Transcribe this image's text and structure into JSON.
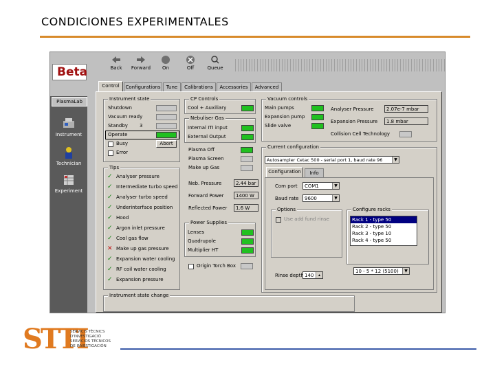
{
  "slide": {
    "title": "CONDICIONES EXPERIMENTALES"
  },
  "toolbar": {
    "logo": "Beta",
    "buttons": [
      {
        "label": "Back",
        "icon": "back-arrow-icon"
      },
      {
        "label": "Forward",
        "icon": "forward-arrow-icon"
      },
      {
        "label": "On",
        "icon": "on-circle-icon"
      },
      {
        "label": "Off",
        "icon": "off-circle-icon"
      },
      {
        "label": "Queue",
        "icon": "queue-magnifier-icon"
      }
    ]
  },
  "sidebar": {
    "header": "PlasmaLab",
    "items": [
      {
        "label": "Instrument",
        "icon": "instrument-icon"
      },
      {
        "label": "Technician",
        "icon": "technician-icon"
      },
      {
        "label": "Experiment",
        "icon": "experiment-icon"
      }
    ]
  },
  "tabs": [
    "Control",
    "Configurations",
    "Tune",
    "Calibrations",
    "Accessories",
    "Advanced"
  ],
  "instrument_state": {
    "title": "Instrument state",
    "items": [
      {
        "label": "Shutdown"
      },
      {
        "label": "Vacuum ready"
      },
      {
        "label": "Standby",
        "extra": "3"
      },
      {
        "label": "Operate"
      },
      {
        "label": "Busy",
        "button": "Abort"
      },
      {
        "label": "Error"
      }
    ]
  },
  "tips": {
    "title": "Tips",
    "items": [
      {
        "label": "Analyser pressure",
        "status": "ok"
      },
      {
        "label": "Intermediate turbo speed",
        "status": "ok"
      },
      {
        "label": "Analyser turbo speed",
        "status": "ok"
      },
      {
        "label": "Underinterface position",
        "status": "ok"
      },
      {
        "label": "Hood",
        "status": "ok"
      },
      {
        "label": "Argon inlet pressure",
        "status": "ok"
      },
      {
        "label": "Cool gas flow",
        "status": "ok"
      },
      {
        "label": "Make up gas pressure",
        "status": "bad"
      },
      {
        "label": "Expansion water cooling",
        "status": "ok"
      },
      {
        "label": "RF coil water cooling",
        "status": "ok"
      },
      {
        "label": "Expansion pressure",
        "status": "ok"
      }
    ],
    "ok_glyph": "✓",
    "bad_glyph": "✕"
  },
  "instrument_state_change": {
    "title": "Instrument state change"
  },
  "cp_controls": {
    "title": "CP Controls",
    "items": [
      {
        "label": "Cool + Auxiliary"
      }
    ]
  },
  "nebuliser_gas": {
    "title": "Nebuliser Gas",
    "items": [
      {
        "label": "Internal ITI input"
      },
      {
        "label": "External Output"
      }
    ]
  },
  "plasma": {
    "items": [
      {
        "label": "Plasma Off"
      },
      {
        "label": "Plasma Screen"
      },
      {
        "label": "Make up Gas"
      }
    ],
    "readouts": [
      {
        "label": "Neb. Pressure",
        "value": "2.44 bar"
      },
      {
        "label": "Forward Power",
        "value": "1400 W"
      },
      {
        "label": "Reflected Power",
        "value": "1.6 W"
      }
    ]
  },
  "power_supplies": {
    "title": "Power Supplies",
    "items": [
      {
        "label": "Lenses"
      },
      {
        "label": "Quadrupole"
      },
      {
        "label": "Multiplier HT"
      }
    ],
    "checkbox": "Origin Torch Box"
  },
  "vacuum_controls": {
    "title": "Vacuum controls",
    "items": [
      {
        "label": "Main pumps"
      },
      {
        "label": "Expansion pump"
      },
      {
        "label": "Slide valve"
      }
    ],
    "readouts": [
      {
        "label": "Analyser Pressure",
        "value": "2.07e-7 mbar"
      },
      {
        "label": "Expansion Pressure",
        "value": "1.8 mbar"
      }
    ],
    "collision_label": "Collision Cell Technology"
  },
  "current_configuration": {
    "title": "Current configuration",
    "value": "Autosampler Cetac 500 - serial port 1, baud rate 96",
    "subtabs": [
      "Configuration",
      "Info"
    ],
    "com_port_label": "Com port",
    "com_port_value": "COM1",
    "baud_rate_label": "Baud rate",
    "baud_rate_value": "9600",
    "options_title": "Options",
    "options_checkbox": "Use add fund rinse",
    "racks_title": "Configure racks",
    "racks": [
      "Rack 1 - type 50",
      "Rack 2 - type 50",
      "Rack 3 - type 10",
      "Rack 4 - type 50"
    ],
    "rinse_label": "Rinse depth",
    "rinse_value": "140",
    "rack_size_value": "10 - 5 * 12 (5100)"
  },
  "footer": {
    "logo": "STTI",
    "lines": [
      "SERVICIS TÈCNICS",
      "D'INVESTIGACIÓ",
      "SERVICIOS TÉCNICOS",
      "DE INVESTIGACIÓN"
    ]
  },
  "colors": {
    "accent_rule": "#d88a2a",
    "footer_rule": "#3a5aa8",
    "indicator_on": "#20c020",
    "logo": "#e07a20"
  }
}
